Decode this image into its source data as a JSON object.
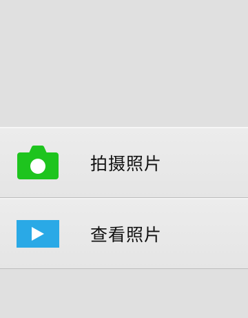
{
  "menu": {
    "items": [
      {
        "label": "拍摄照片",
        "icon": "camera-icon",
        "icon_color": "#1ec41e"
      },
      {
        "label": "查看照片",
        "icon": "play-icon",
        "icon_color": "#2aa9e6"
      }
    ]
  }
}
